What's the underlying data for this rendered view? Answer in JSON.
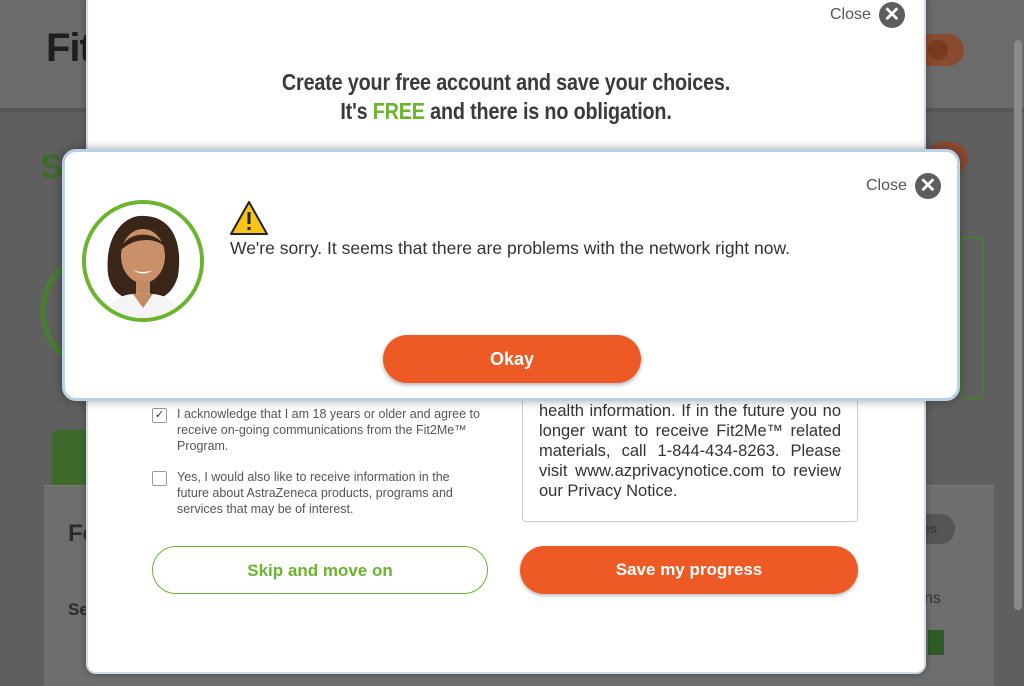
{
  "background": {
    "logo_prefix": "Fit",
    "heading_fragment": "S",
    "section_fragment": "Fo",
    "label_fragment": "Se",
    "right_fragment": "ns",
    "pill_fragment": "es"
  },
  "account_modal": {
    "close_label": "Close",
    "headline_line1": "Create your free account and save your choices.",
    "headline_line2_prefix": "It's ",
    "headline_line2_free": "FREE",
    "headline_line2_suffix": " and there is no obligation.",
    "consent_checkbox": {
      "checked": true,
      "label": "I acknowledge that I am 18 years or older and agree to receive on-going communications from the Fit2Me™ Program."
    },
    "marketing_checkbox": {
      "checked": false,
      "label": "Yes, I would also like to receive information in the future about AstraZeneca products, programs and services that may be of interest."
    },
    "privacy_text": "health information. If in the future you no longer want to receive Fit2Me™ related materials, call 1-844-434-8263. Please visit www.azprivacynotice.com to review our Privacy Notice.",
    "skip_button": "Skip and move on",
    "save_button": "Save my progress"
  },
  "error_dialog": {
    "close_label": "Close",
    "message": "We're sorry. It seems that there are problems with the network right now.",
    "okay_button": "Okay"
  },
  "colors": {
    "accent_orange": "#ee5a25",
    "accent_green": "#6ab42f",
    "overlay": "#5f5f5f"
  }
}
